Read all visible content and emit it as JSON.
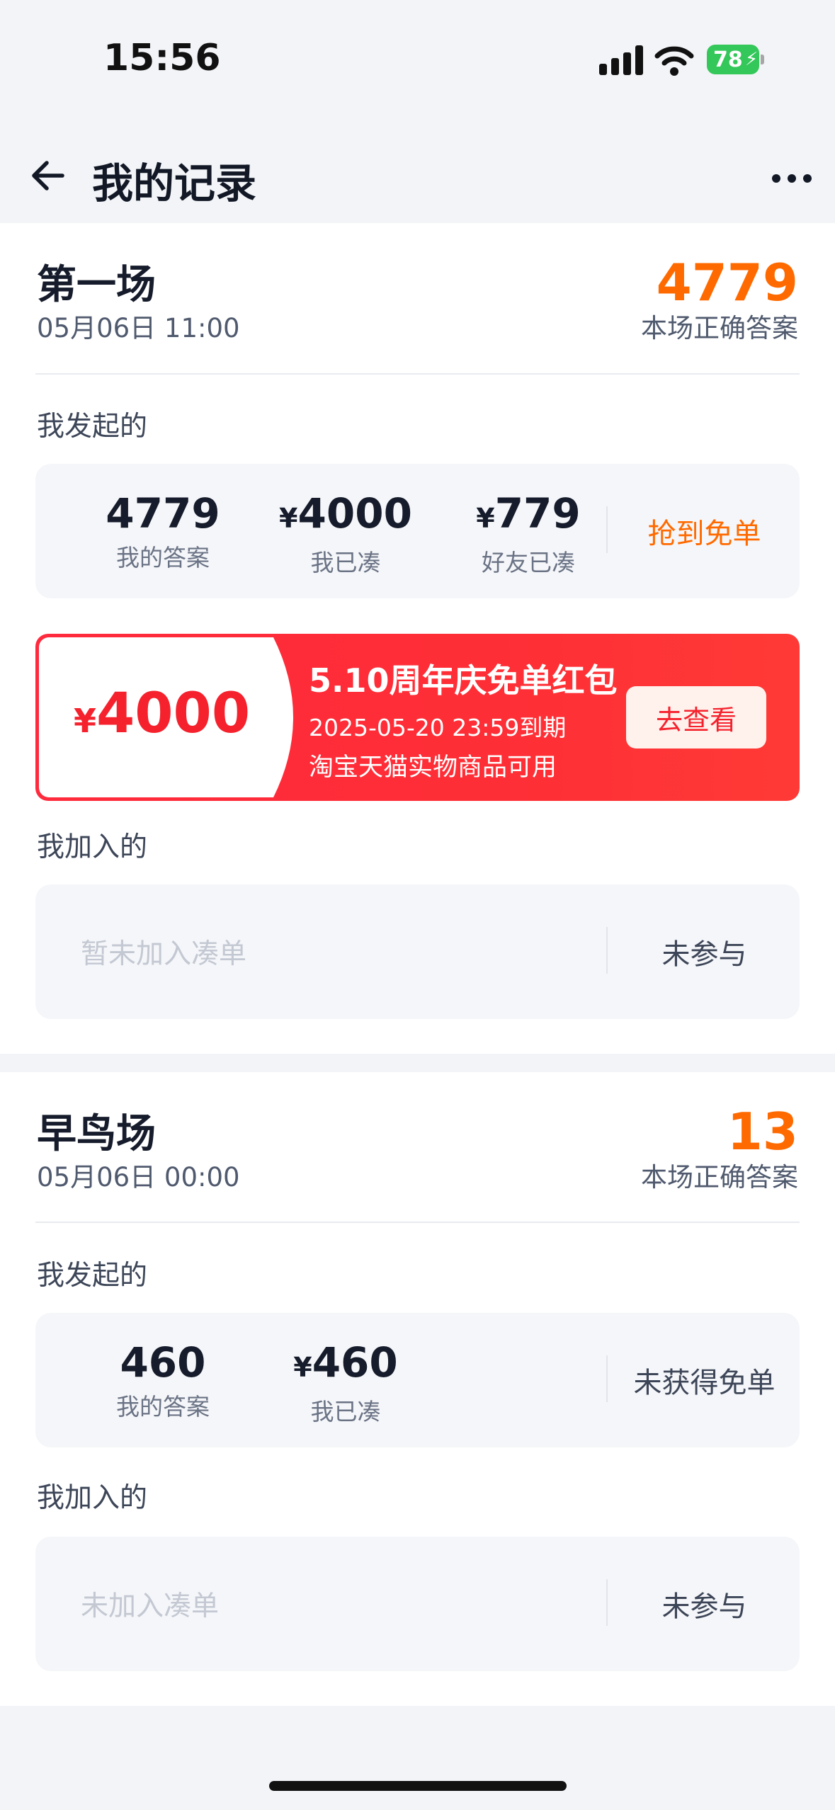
{
  "status_bar": {
    "time": "15:56",
    "battery": "78"
  },
  "nav": {
    "title": "我的记录"
  },
  "sessions": [
    {
      "name": "第一场",
      "time": "05月06日 11:00",
      "answer": "4779",
      "answer_label": "本场正确答案",
      "initiated_label": "我发起的",
      "initiated": {
        "my_answer_value": "4779",
        "my_answer_label": "我的答案",
        "my_paid_yen": "¥",
        "my_paid_value": "4000",
        "my_paid_label": "我已凑",
        "friend_paid_yen": "¥",
        "friend_paid_value": "779",
        "friend_paid_label": "好友已凑",
        "result": "抢到免单"
      },
      "coupon": {
        "yen": "¥",
        "amount": "4000",
        "title": "5.10周年庆免单红包",
        "expiry": "2025-05-20 23:59到期",
        "scope": "淘宝天猫实物商品可用",
        "button": "去查看"
      },
      "joined_label": "我加入的",
      "joined": {
        "empty_text": "暂未加入凑单",
        "result": "未参与"
      }
    },
    {
      "name": "早鸟场",
      "time": "05月06日 00:00",
      "answer": "13",
      "answer_label": "本场正确答案",
      "initiated_label": "我发起的",
      "initiated": {
        "my_answer_value": "460",
        "my_answer_label": "我的答案",
        "my_paid_yen": "¥",
        "my_paid_value": "460",
        "my_paid_label": "我已凑",
        "result": "未获得免单"
      },
      "joined_label": "我加入的",
      "joined": {
        "empty_text": "未加入凑单",
        "result": "未参与"
      }
    }
  ],
  "colors": {
    "accent_orange": "#ff6a00",
    "coupon_red": "#ff2a3d",
    "page_bg": "#f2f4f7"
  }
}
